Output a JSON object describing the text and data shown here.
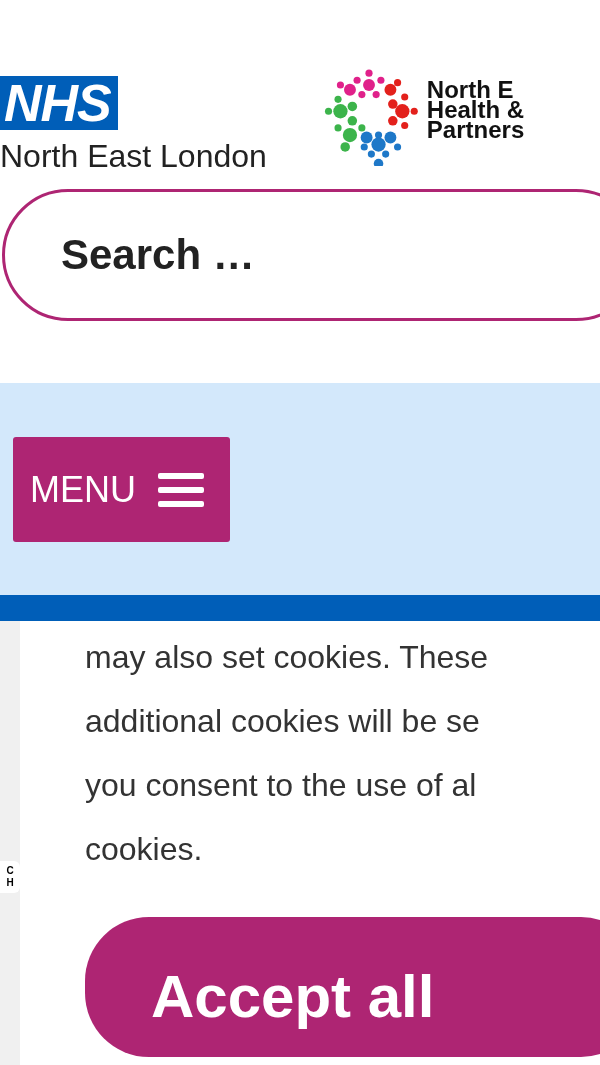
{
  "header": {
    "nhs_logo": {
      "badge": "NHS",
      "region": "North East London"
    },
    "partner_logo": {
      "lines": [
        "North E",
        "Health &",
        "Partners"
      ]
    }
  },
  "search": {
    "placeholder": "Search …"
  },
  "nav": {
    "menu_button": "MENU"
  },
  "side_tab": {
    "lines": [
      "C",
      "H"
    ]
  },
  "cookie_notice": {
    "lines": [
      "may also set cookies. These",
      "additional cookies will be se",
      "you consent to the use of al",
      "cookies."
    ],
    "accept_button": "Accept all"
  }
}
